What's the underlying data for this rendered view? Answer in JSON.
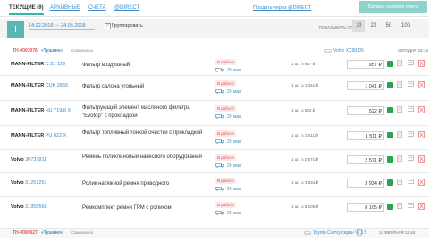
{
  "tabs": [
    {
      "label": "ТЕКУЩИЕ (9)",
      "active": true
    },
    {
      "label": "АРХИВНЫЕ"
    },
    {
      "label": "СЧЕТА"
    },
    {
      "label": "@DIRECT"
    }
  ],
  "direct_link": "Продать через @DIRECT",
  "balance_button": "Баланс личного счета",
  "filter": {
    "plus": "+",
    "date_range": "14.02.2018 — 24.05.2018",
    "group_label": "Группировать",
    "group_checked": true,
    "show_rows_label": "ПОКАЗЫВАТЬ СТРОК:",
    "page_sizes": [
      "10",
      "20",
      "50",
      "100"
    ],
    "active_page_size": "10"
  },
  "orders": [
    {
      "id": "TH-0003076",
      "shop": "«Тушино»",
      "city": "Самовывоз",
      "car": "Volvo XC90 D5",
      "date": "СЕГОДНЯ 16:14",
      "items": [
        {
          "brand": "MANN-FILTER",
          "article": "C 23 129",
          "name": "Фильтр воздушный",
          "status": "В работе",
          "delivery": "29 мая",
          "qty": "1 шт. x 957 ₽",
          "total": "957 ₽"
        },
        {
          "brand": "MANN-FILTER",
          "article": "CUK 2855",
          "name": "Фильтр салона угольный",
          "status": "В работе",
          "delivery": "29 мая",
          "qty": "1 шт. x 1 041 ₽",
          "total": "1 041 ₽"
        },
        {
          "brand": "MANN-FILTER",
          "article": "HU 719/8 X",
          "name": "Фильтрующий элемент масляного фильтра \"Evotop\" с прокладкой",
          "status": "В работе",
          "delivery": "29 мая",
          "qty": "1 шт. x 522 ₽",
          "total": "522 ₽"
        },
        {
          "brand": "MANN-FILTER",
          "article": "PU 823 X",
          "name": "Фильтр топливный тонкой очистки с прокладкой",
          "status": "В работе",
          "delivery": "29 мая",
          "qty": "1 шт. x 1 511 ₽",
          "total": "1 511 ₽"
        },
        {
          "brand": "Volvo",
          "article": "30731811",
          "name": "Ремень поликлиновый навесного оборудования",
          "status": "В работе",
          "delivery": "26 мая",
          "qty": "1 шт. x 2 571 ₽",
          "total": "2 571 ₽"
        },
        {
          "brand": "Volvo",
          "article": "31251251",
          "name": "Ролик натяжной ремня приводного",
          "status": "В работе",
          "delivery": "26 мая",
          "qty": "1 шт. x 3 934 ₽",
          "total": "3 934 ₽"
        },
        {
          "brand": "Volvo",
          "article": "31359568",
          "name": "Ремкомплект ремня ГРМ с роликом",
          "status": "В работе",
          "delivery": "26 мая",
          "qty": "1 шт. x 8 105 ₽",
          "total": "8 105 ₽"
        }
      ]
    },
    {
      "id": "TH-0000627",
      "shop": "«Тушино»",
      "city": "Самовывоз",
      "car": "Toyota Camry седан VI 3.5",
      "date": "14 ФЕВРАЛЯ 13:44"
    }
  ],
  "colors": {
    "accent": "#2fb7a8",
    "link": "#3a8ccf",
    "status": "#e05050"
  }
}
